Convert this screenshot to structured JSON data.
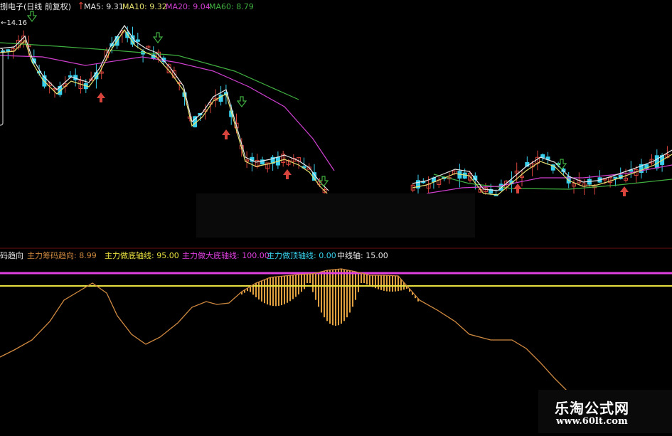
{
  "colors": {
    "background": "#000000",
    "up": "#d8443c",
    "down": "#38d0ec",
    "ma5": "#e8e8e8",
    "ma10": "#e8e070",
    "ma20": "#d040d0",
    "ma60": "#40b040",
    "trend_line": "#d08a40",
    "bars": "#e0a040",
    "top_line": "#e040e0",
    "mid_line": "#e8e040",
    "panel_sep": "#6a1010"
  },
  "top_panel": {
    "stock_title": "捌电子(日线 前复权)",
    "ma5_label": "MA5: 9.31",
    "ma10_label": "MA10: 9.32",
    "ma20_label": "MA20: 9.04",
    "ma60_label": "MA60: 8.79",
    "high_marker": "14.16"
  },
  "bottom_panel": {
    "indicator_name": "码趋向",
    "trend_label": "主力筹码趋向: 8.99",
    "bottom_axis_label": "主力做底轴线: 95.00",
    "big_bottom_label": "主力做大底轴线: 100.00",
    "top_axis_label": "主力做顶轴线: 0.00",
    "mid_axis_label": "中线轴: 15.00"
  },
  "watermark": {
    "site_name": "乐淘公式网",
    "url": "www.60lt.com"
  },
  "chart_data": [
    {
      "type": "candlestick",
      "title": "捌电子(日线 前复权)",
      "series": [
        {
          "name": "MA5",
          "values": [
            9.31
          ]
        },
        {
          "name": "MA10",
          "values": [
            9.32
          ]
        },
        {
          "name": "MA20",
          "values": [
            9.04
          ]
        },
        {
          "name": "MA60",
          "values": [
            8.79
          ]
        }
      ],
      "annotations": [
        "14.16"
      ]
    },
    {
      "type": "line",
      "series": [
        {
          "name": "主力筹码趋向",
          "values": [
            8.99
          ]
        },
        {
          "name": "主力做底轴线",
          "values": [
            95.0
          ]
        },
        {
          "name": "主力做大底轴线",
          "values": [
            100.0
          ]
        },
        {
          "name": "主力做顶轴线",
          "values": [
            0.0
          ]
        },
        {
          "name": "中线轴",
          "values": [
            15.0
          ]
        }
      ]
    }
  ]
}
